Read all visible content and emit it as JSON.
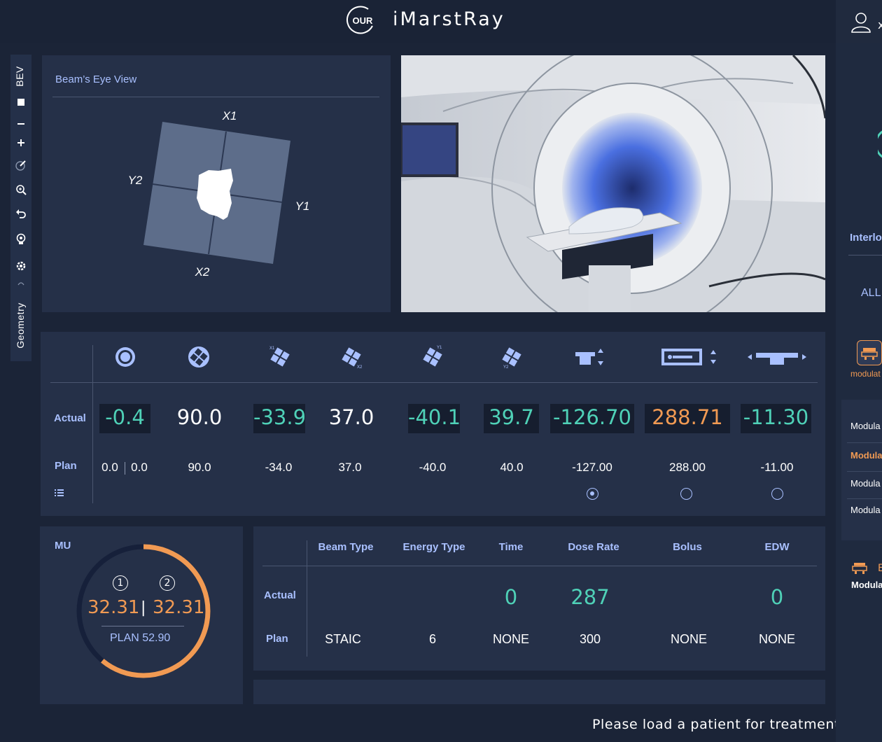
{
  "header": {
    "logo_text": "OUR",
    "app_title": "iMarstRay",
    "user_initial": "x"
  },
  "toolbar": {
    "top_tab": "BEV",
    "bottom_tab": "Geometry",
    "icons": [
      "stop-icon",
      "minus-icon",
      "plus-icon",
      "edit-icon",
      "zoom-icon",
      "undo-icon",
      "light-bulb-icon",
      "gear-icon",
      "chevron-icon"
    ]
  },
  "bev": {
    "title": "Beam’s Eye View",
    "labels": {
      "x1": "X1",
      "x2": "X2",
      "y1": "Y1",
      "y2": "Y2"
    }
  },
  "geometry": {
    "row_actual": "Actual",
    "row_plan": "Plan",
    "columns": [
      {
        "icon": "gantry-icon",
        "actual": "-0.4",
        "plan": "0.0",
        "plan_extra": "0.0",
        "actual_color": "#4fd1b7",
        "boxed": true
      },
      {
        "icon": "collimator-icon",
        "actual": "90.0",
        "plan": "90.0",
        "actual_color": "#ffffff",
        "boxed": false
      },
      {
        "icon": "jaw-x1-icon",
        "actual": "-33.9",
        "plan": "-34.0",
        "actual_color": "#4fd1b7",
        "boxed": true
      },
      {
        "icon": "jaw-x2-icon",
        "actual": "37.0",
        "plan": "37.0",
        "actual_color": "#ffffff",
        "boxed": false
      },
      {
        "icon": "jaw-y1-icon",
        "actual": "-40.1",
        "plan": "-40.0",
        "actual_color": "#4fd1b7",
        "boxed": true
      },
      {
        "icon": "jaw-y2-icon",
        "actual": "39.7",
        "plan": "40.0",
        "actual_color": "#4fd1b7",
        "boxed": true
      },
      {
        "icon": "couch-vertical-icon",
        "actual": "-126.70",
        "plan": "-127.00",
        "actual_color": "#4fd1b7",
        "boxed": true
      },
      {
        "icon": "couch-longitudinal-icon",
        "actual": "288.71",
        "plan": "288.00",
        "actual_color": "#f19a53",
        "boxed": true
      },
      {
        "icon": "couch-lateral-icon",
        "actual": "-11.30",
        "plan": "-11.00",
        "actual_color": "#4fd1b7",
        "boxed": true
      }
    ]
  },
  "mu": {
    "title": "MU",
    "channel1": "1",
    "channel2": "2",
    "value1": "32.31",
    "value2": "32.31",
    "separator": "|",
    "plan_label": "PLAN",
    "plan_value": "52.90",
    "progress": 0.61
  },
  "beam": {
    "headers": [
      "Beam Type",
      "Energy Type",
      "Time",
      "Dose Rate",
      "Bolus",
      "EDW"
    ],
    "row_actual": "Actual",
    "row_plan": "Plan",
    "actual": [
      "",
      "",
      "0",
      "287",
      "",
      "0"
    ],
    "plan": [
      "STAIC",
      "6",
      "NONE",
      "300",
      "NONE",
      "NONE"
    ]
  },
  "status": {
    "message": "Please load a patient for treatment"
  },
  "right_panel": {
    "interlock_title": "Interlo",
    "all_label": "ALL",
    "active_label": "modulat",
    "items": [
      "Modula",
      "Modula",
      "Modula",
      "Modula"
    ],
    "second_icon_letter": "E",
    "second_label": "Modula"
  },
  "colors": {
    "accent_label": "#a9c0ff",
    "teal": "#4fd1b7",
    "orange": "#f19a53"
  }
}
